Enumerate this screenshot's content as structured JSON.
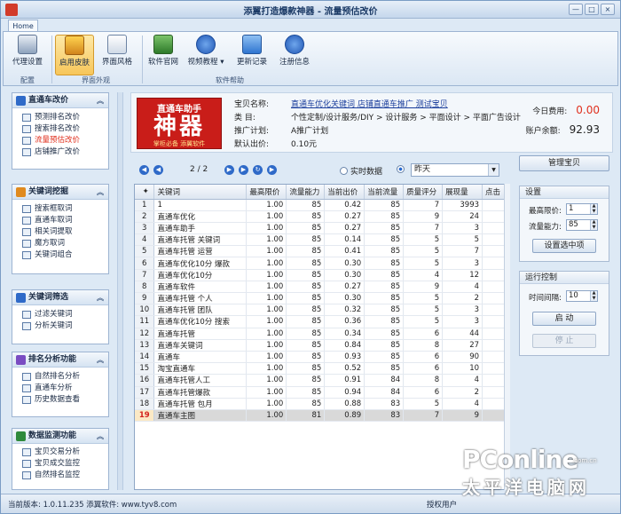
{
  "window": {
    "title": "添翼打造爆款神器 - 流量预估改价",
    "controls": [
      "—",
      "□",
      "×"
    ]
  },
  "ribbon": {
    "tab": "Home",
    "groups": [
      {
        "label": "配置",
        "buttons": [
          {
            "label": "代理设置",
            "icon": "proxy-settings-icon"
          }
        ]
      },
      {
        "label": "界面外观",
        "buttons": [
          {
            "label": "启用皮肤",
            "icon": "skin-icon",
            "active": true
          },
          {
            "label": "界面风格",
            "icon": "cursor-style-icon"
          }
        ]
      },
      {
        "label": "软件帮助",
        "buttons": [
          {
            "label": "软件官网",
            "icon": "home-icon"
          },
          {
            "label": "视频教程 ▾",
            "icon": "help-icon"
          },
          {
            "label": "更新记录",
            "icon": "star-icon"
          },
          {
            "label": "注册信息",
            "icon": "info-icon"
          }
        ]
      }
    ]
  },
  "sidebar": {
    "sections": [
      {
        "title": "直通车改价",
        "items": [
          "预测排名改价",
          "搜索排名改价",
          "流量预估改价",
          "店铺推广改价"
        ],
        "highlight": 2
      },
      {
        "title": "关键词挖掘",
        "items": [
          "搜索框取词",
          "直通车取词",
          "相关词提取",
          "魔方取词",
          "关键词组合"
        ]
      },
      {
        "title": "关键词筛选",
        "items": [
          "过滤关键词",
          "分析关键词"
        ]
      },
      {
        "title": "排名分析功能",
        "items": [
          "自然排名分析",
          "直通车分析",
          "历史数据查看"
        ]
      },
      {
        "title": "数据监测功能",
        "items": [
          "宝贝交易分析",
          "宝贝成交监控",
          "自然排名监控"
        ]
      }
    ]
  },
  "logo": {
    "line1": "直通车助手",
    "line2": "神器",
    "line3": "掌柜必备 添翼软件"
  },
  "product": {
    "name_label": "宝贝名称:",
    "name_value": "直通车优化关键词 店铺直通车推广  测试宝贝",
    "category_label": "类    目:",
    "category_value": "个性定制/设计服务/DIY > 设计服务 > 平面设计 > 平面广告设计",
    "plan_label": "推广计划:",
    "plan_value": "A推广计划",
    "default_bid_label": "默认出价:",
    "default_bid_value": "0.10元"
  },
  "fees": {
    "today_label": "今日费用:",
    "today_value": "0.00",
    "balance_label": "账户余额:",
    "balance_value": "92.93"
  },
  "pager": {
    "text": "2 / 2",
    "radio_realtime": "实时数据",
    "radio_yesterday": "昨天",
    "select_value": "昨天"
  },
  "grid": {
    "columns": [
      "关键词",
      "最高限价",
      "流量能力",
      "当前出价",
      "当前流量",
      "质量评分",
      "展现量",
      "点击"
    ],
    "rows": [
      [
        "1",
        "1",
        "1.00",
        "85",
        "0.42",
        "85",
        "7",
        "3993"
      ],
      [
        "2",
        "直通车优化",
        "1.00",
        "85",
        "0.27",
        "85",
        "9",
        "24"
      ],
      [
        "3",
        "直通车助手",
        "1.00",
        "85",
        "0.27",
        "85",
        "7",
        "3"
      ],
      [
        "4",
        "直通车托管 关键词",
        "1.00",
        "85",
        "0.14",
        "85",
        "5",
        "5"
      ],
      [
        "5",
        "直通车托管 运营",
        "1.00",
        "85",
        "0.41",
        "85",
        "5",
        "7"
      ],
      [
        "6",
        "直通车优化10分 爆款",
        "1.00",
        "85",
        "0.30",
        "85",
        "5",
        "3"
      ],
      [
        "7",
        "直通车优化10分",
        "1.00",
        "85",
        "0.30",
        "85",
        "4",
        "12"
      ],
      [
        "8",
        "直通车软件",
        "1.00",
        "85",
        "0.27",
        "85",
        "9",
        "4"
      ],
      [
        "9",
        "直通车托管 个人",
        "1.00",
        "85",
        "0.30",
        "85",
        "5",
        "2"
      ],
      [
        "10",
        "直通车托管 团队",
        "1.00",
        "85",
        "0.32",
        "85",
        "5",
        "3"
      ],
      [
        "11",
        "直通车优化10分 搜索",
        "1.00",
        "85",
        "0.36",
        "85",
        "5",
        "3"
      ],
      [
        "12",
        "直通车托管",
        "1.00",
        "85",
        "0.34",
        "85",
        "6",
        "44"
      ],
      [
        "13",
        "直通车关键词",
        "1.00",
        "85",
        "0.84",
        "85",
        "8",
        "27"
      ],
      [
        "14",
        "直通车",
        "1.00",
        "85",
        "0.93",
        "85",
        "6",
        "90"
      ],
      [
        "15",
        "淘宝直通车",
        "1.00",
        "85",
        "0.52",
        "85",
        "6",
        "10"
      ],
      [
        "16",
        "直通车托管人工",
        "1.00",
        "85",
        "0.91",
        "84",
        "8",
        "4"
      ],
      [
        "17",
        "直通车托管爆款",
        "1.00",
        "85",
        "0.94",
        "84",
        "6",
        "2"
      ],
      [
        "18",
        "直通车托管 包月",
        "1.00",
        "85",
        "0.88",
        "83",
        "5",
        "4"
      ],
      [
        "19",
        "直通车主图",
        "1.00",
        "81",
        "0.89",
        "83",
        "7",
        "9"
      ]
    ],
    "selected_row": 18
  },
  "right": {
    "manage_button": "管理宝贝",
    "settings_title": "设置",
    "max_price_label": "最高限价:",
    "max_price_value": "1",
    "traffic_label": "流量能力:",
    "traffic_value": "85",
    "apply_button": "设置选中项",
    "run_title": "运行控制",
    "interval_label": "时间间隔:",
    "interval_value": "10",
    "start_button": "启  动",
    "stop_button": "停  止"
  },
  "status": {
    "left": "当前版本: 1.0.11.235 添翼软件: www.tyv8.com",
    "right": "授权用户"
  },
  "watermark": {
    "brand": "PConline",
    "domain": ".com.cn",
    "cn": "太平洋电脑网"
  },
  "colors": {
    "accent": "#2f6ac8",
    "danger": "#e0301e",
    "logo": "#c91d19",
    "active": "#f7c65a"
  }
}
